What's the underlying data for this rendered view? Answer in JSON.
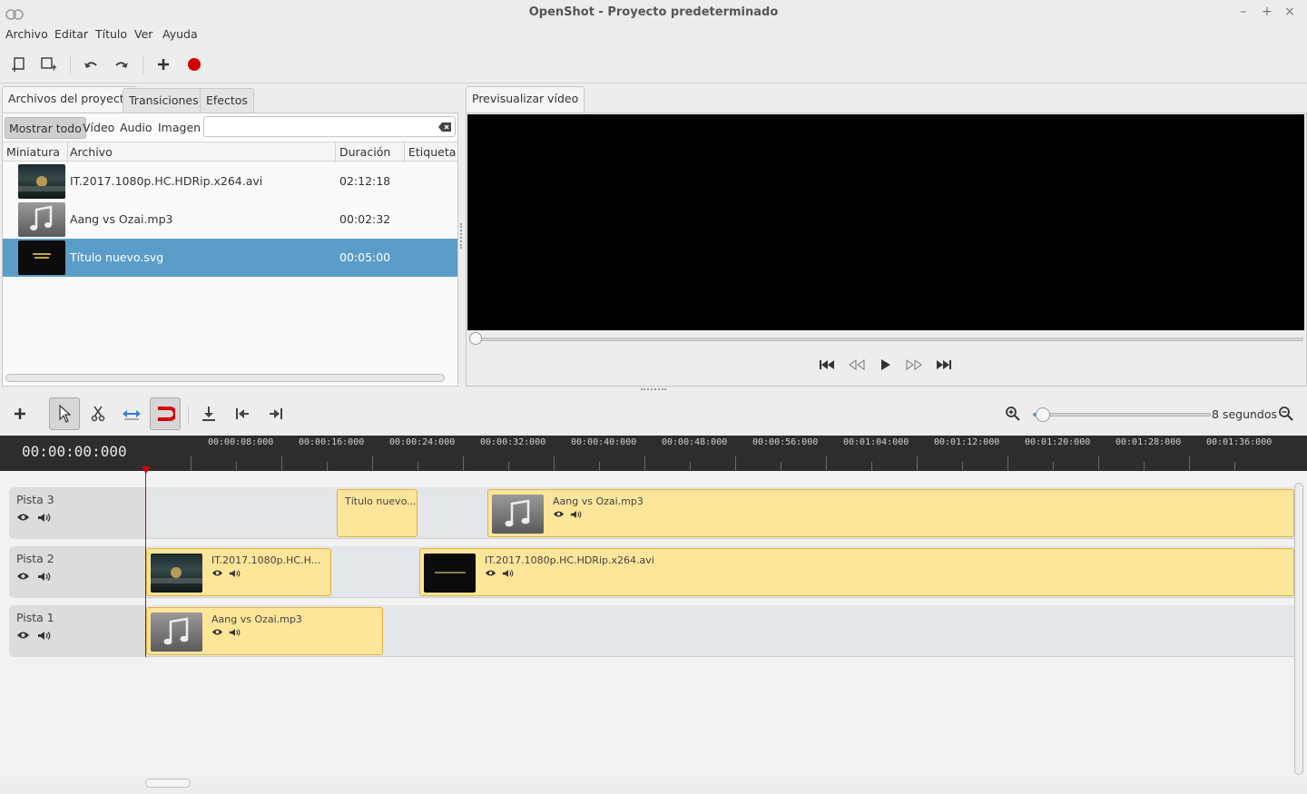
{
  "window": {
    "title": "OpenShot - Proyecto predeterminado",
    "minimize": "–",
    "maximize": "+",
    "close": "×"
  },
  "menu": [
    "Archivo",
    "Editar",
    "Título",
    "Ver",
    "Ayuda"
  ],
  "left_tabs": [
    "Archivos del proyecto",
    "Transiciones",
    "Efectos"
  ],
  "filters": [
    "Mostrar todo",
    "Vídeo",
    "Audio",
    "Imagen"
  ],
  "search": {
    "value": "",
    "placeholder": ""
  },
  "columns": [
    "Miniatura",
    "Archivo",
    "Duración",
    "Etiqueta"
  ],
  "files": [
    {
      "name": "IT.2017.1080p.HC.HDRip.x264.avi",
      "duration": "02:12:18",
      "tag": "",
      "selected": false,
      "type": "video"
    },
    {
      "name": "Aang vs Ozai.mp3",
      "duration": "00:02:32",
      "tag": "",
      "selected": false,
      "type": "audio"
    },
    {
      "name": "Título nuevo.svg",
      "duration": "00:05:00",
      "tag": "",
      "selected": true,
      "type": "title"
    }
  ],
  "preview": {
    "tab": "Previsualizar vídeo"
  },
  "timeline": {
    "timecode": "00:00:00:000",
    "zoom_label": "8 segundos",
    "ruler_labels": [
      "00:00:08:000",
      "00:00:16:000",
      "00:00:24:000",
      "00:00:32:000",
      "00:00:40:000",
      "00:00:48:000",
      "00:00:56:000",
      "00:01:04:000",
      "00:01:12:000",
      "00:01:20:000",
      "00:01:28:000",
      "00:01:36:000"
    ],
    "tracks": [
      {
        "name": "Pista 3",
        "clips": [
          {
            "label": "Título nuevo....",
            "type": "title"
          },
          {
            "label": "Aang vs Ozai.mp3",
            "type": "audio"
          }
        ]
      },
      {
        "name": "Pista 2",
        "clips": [
          {
            "label": "IT.2017.1080p.HC.H...",
            "type": "video"
          },
          {
            "label": "IT.2017.1080p.HC.HDRip.x264.avi",
            "type": "video-dark"
          }
        ]
      },
      {
        "name": "Pista 1",
        "clips": [
          {
            "label": "Aang vs Ozai.mp3",
            "type": "audio"
          }
        ]
      }
    ]
  },
  "colors": {
    "selection": "#5b9dc9",
    "clip": "#fde59a",
    "playhead": "#d40000",
    "record": "#d40000"
  }
}
